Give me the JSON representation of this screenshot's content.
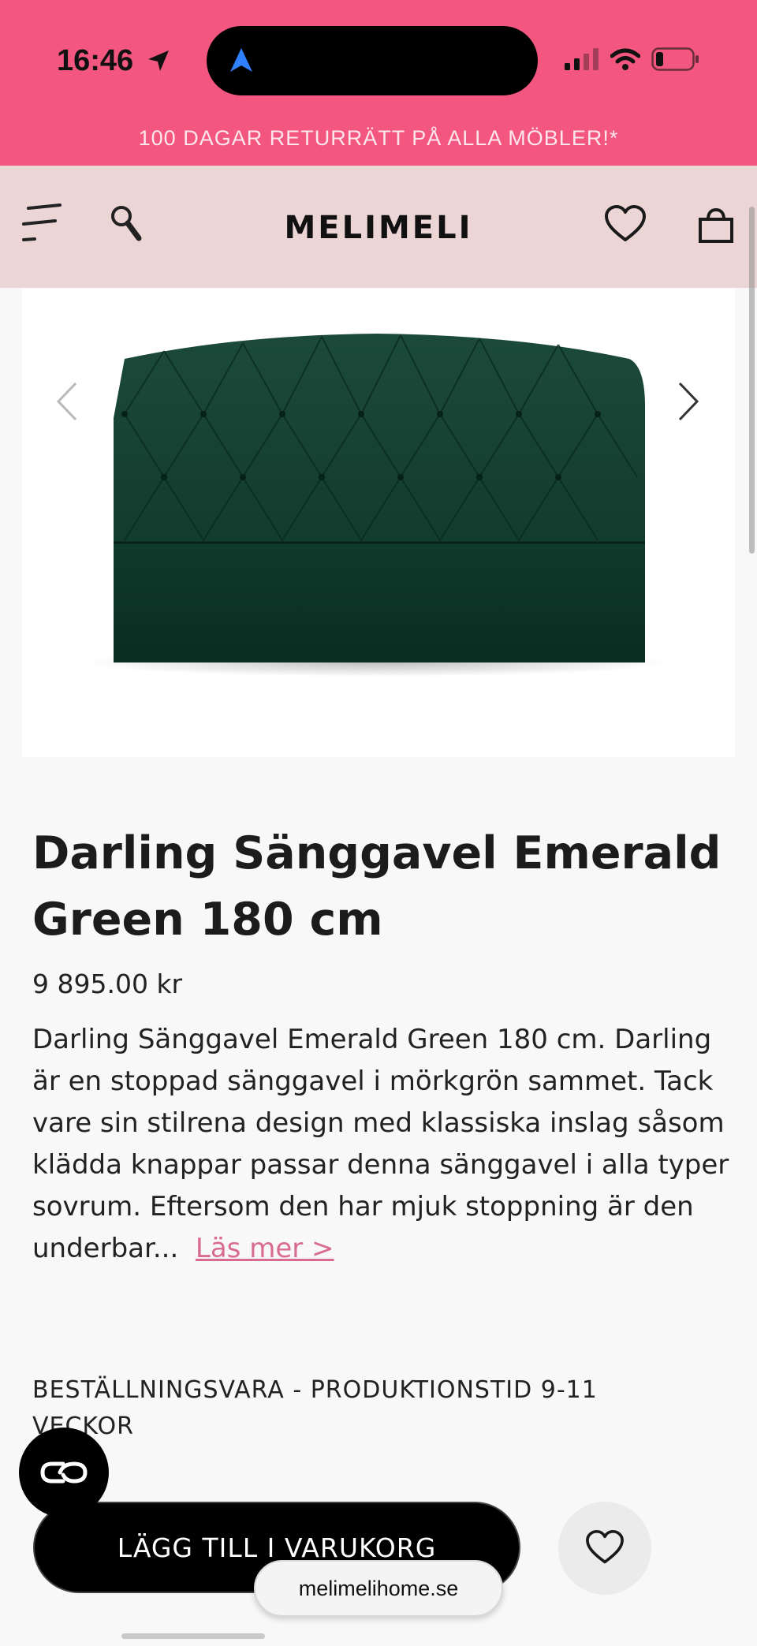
{
  "status_bar": {
    "time": "16:46",
    "battery_level": 0.2
  },
  "promo_banner": {
    "text": "100 DAGAR RETURRÄTT PÅ ALLA MÖBLER!*"
  },
  "header": {
    "logo": "MELIMELI"
  },
  "product": {
    "title": "Darling Sänggavel Emerald Green 180 cm",
    "price": "9 895.00 kr",
    "description": "Darling Sänggavel Emerald Green 180 cm. Darling är en stoppad sänggavel i mörkgrön sammet. Tack vare sin stilrena design med klassiska inslag såsom klädda knappar passar denna sänggavel i alla typer sovrum. Eftersom den har mjuk stoppning är den underbar...",
    "read_more": "Läs mer >",
    "lead_time": "BESTÄLLNINGSVARA - PRODUKTIONSTID 9-11 VECKOR"
  },
  "actions": {
    "add_to_cart": "LÄGG TILL I VARUKORG"
  },
  "browser": {
    "url": "melimelihome.se"
  },
  "colors": {
    "topbar": "#f3567e",
    "header": "#ecd5d5",
    "link": "#d96a92",
    "product": "#0f3b2c"
  }
}
